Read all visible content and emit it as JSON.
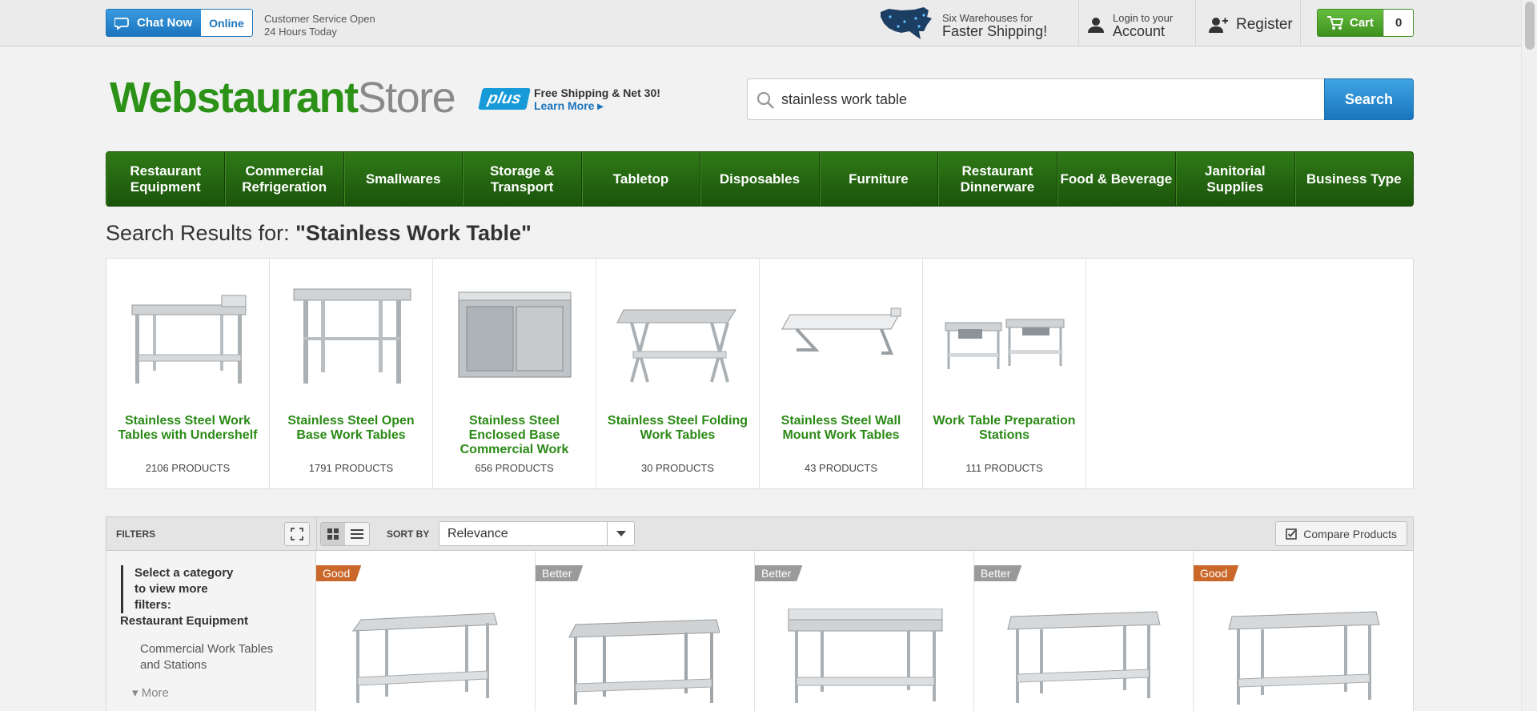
{
  "topbar": {
    "chat_label": "Chat Now",
    "chat_status": "Online",
    "service_line1": "Customer Service Open",
    "service_line2": "24 Hours Today",
    "warehouse_line1": "Six Warehouses for",
    "warehouse_line2": "Faster Shipping!",
    "account_line1": "Login to your",
    "account_line2": "Account",
    "register_label": "Register",
    "cart_label": "Cart",
    "cart_count": "0"
  },
  "header": {
    "logo_primary": "Webstaurant",
    "logo_secondary": "Store",
    "plus_badge": "plus",
    "plus_tagline": "Free Shipping & Net 30!",
    "plus_link": "Learn More ▸"
  },
  "search": {
    "value": "stainless work table",
    "button_label": "Search"
  },
  "nav": {
    "items": [
      {
        "label": "Restaurant Equipment"
      },
      {
        "label": "Commercial Refrigeration"
      },
      {
        "label": "Smallwares"
      },
      {
        "label": "Storage & Transport"
      },
      {
        "label": "Tabletop"
      },
      {
        "label": "Disposables"
      },
      {
        "label": "Furniture"
      },
      {
        "label": "Restaurant Dinnerware"
      },
      {
        "label": "Food & Beverage"
      },
      {
        "label": "Janitorial Supplies"
      },
      {
        "label": "Business Type"
      }
    ]
  },
  "results": {
    "prefix": "Search Results for: ",
    "query": "\"Stainless Work Table\""
  },
  "categories": [
    {
      "name": "Stainless Steel Work Tables with Undershelf",
      "count": "2106 PRODUCTS"
    },
    {
      "name": "Stainless Steel Open Base Work Tables",
      "count": "1791 PRODUCTS"
    },
    {
      "name": "Stainless Steel Enclosed Base Commercial Work Tables",
      "count": "656 PRODUCTS"
    },
    {
      "name": "Stainless Steel Folding Work Tables",
      "count": "30 PRODUCTS"
    },
    {
      "name": "Stainless Steel Wall Mount Work Tables",
      "count": "43 PRODUCTS"
    },
    {
      "name": "Work Table Preparation Stations",
      "count": "111 PRODUCTS"
    }
  ],
  "filter_bar": {
    "filters_label": "FILTERS",
    "sort_label": "SORT BY",
    "sort_value": "Relevance",
    "compare_label": "Compare Products"
  },
  "sidebar": {
    "hint": "Select a category to view more filters:",
    "heading": "Restaurant Equipment",
    "link": "Commercial Work Tables and Stations",
    "more": "▾ More"
  },
  "products": [
    {
      "badge": "Good"
    },
    {
      "badge": "Better"
    },
    {
      "badge": "Better"
    },
    {
      "badge": "Better"
    },
    {
      "badge": "Good"
    }
  ],
  "colors": {
    "brand_green": "#2b9217",
    "nav_green": "#1f5e0f",
    "search_blue": "#1a76be",
    "badge_good": "#c9682a",
    "badge_better": "#9a9a9a"
  }
}
